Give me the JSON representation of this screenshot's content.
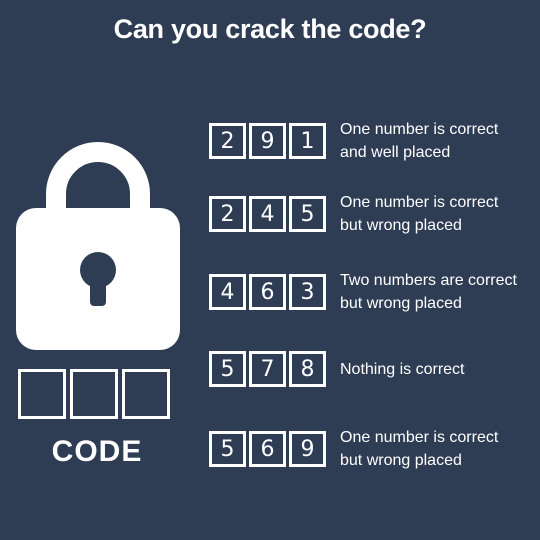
{
  "title": "Can you crack the code?",
  "code_label": "CODE",
  "code_slots": [
    "",
    "",
    ""
  ],
  "colors": {
    "background": "#2e3d54",
    "foreground": "#ffffff"
  },
  "lock_icon": "padlock-icon",
  "clues": [
    {
      "digits": [
        "2",
        "9",
        "1"
      ],
      "line1": "One number is correct",
      "line2": "and well placed"
    },
    {
      "digits": [
        "2",
        "4",
        "5"
      ],
      "line1": "One number is correct",
      "line2": "but wrong placed"
    },
    {
      "digits": [
        "4",
        "6",
        "3"
      ],
      "line1": "Two numbers are correct",
      "line2": "but wrong placed"
    },
    {
      "digits": [
        "5",
        "7",
        "8"
      ],
      "line1": "Nothing is correct",
      "line2": ""
    },
    {
      "digits": [
        "5",
        "6",
        "9"
      ],
      "line1": "One number is correct",
      "line2": "but wrong placed"
    }
  ]
}
